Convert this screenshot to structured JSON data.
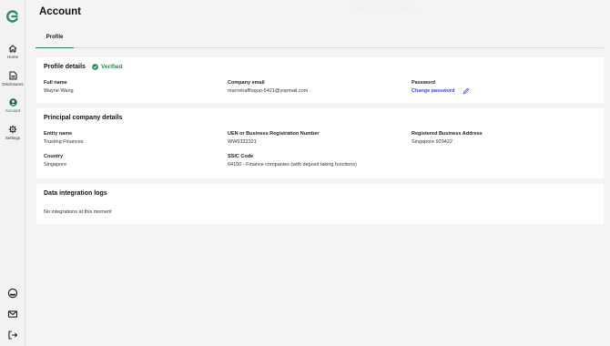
{
  "sidebar": {
    "items": [
      {
        "label": "Home",
        "icon": "home-icon"
      },
      {
        "label": "Disclosures",
        "icon": "document-icon"
      },
      {
        "label": "Account",
        "icon": "user-icon"
      },
      {
        "label": "Settings",
        "icon": "gear-icon"
      }
    ],
    "bottom_icons": [
      "support-icon",
      "mail-icon",
      "logout-icon"
    ],
    "active_color": "#1a6b4a"
  },
  "page": {
    "title": "Account",
    "faded_header_text": "Browser for this URL, request link"
  },
  "tabs": [
    {
      "label": "Profile",
      "active": true
    }
  ],
  "profile": {
    "title": "Profile details",
    "verified_label": "Verified",
    "full_name_label": "Full name",
    "full_name": "Wayne Wang",
    "email_label": "Company email",
    "email": "macreiraffluquo-5421@yopmail.com",
    "password_label": "Password",
    "change_password": "Change password"
  },
  "company": {
    "title": "Principal company details",
    "entity_label": "Entity name",
    "entity": "Trusting Finances",
    "uen_label": "UEN or Business Registration Number",
    "uen": "WW9322321",
    "address_label": "Registered Business Address",
    "address": "Singapore 929422",
    "country_label": "Country",
    "country": "Singapore",
    "ssic_label": "SSIC Code",
    "ssic": "64150 - Finance companies (with deposit taking functions)"
  },
  "integrations": {
    "title": "Data integration logs",
    "empty_text": "No integrations at this moment"
  },
  "colors": {
    "accent_green": "#1f8a4c",
    "link_blue": "#3b4ad1"
  }
}
